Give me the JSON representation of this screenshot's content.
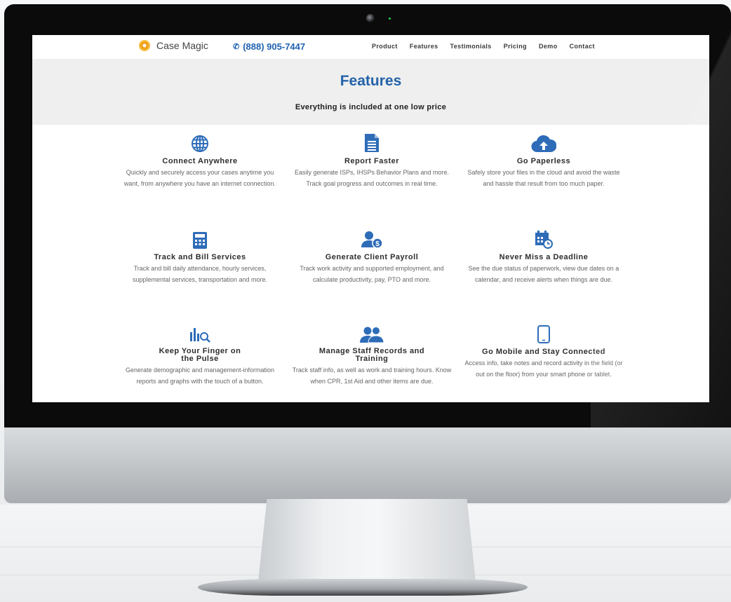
{
  "brand": {
    "name": "Case Magic",
    "phone": "(888) 905-7447"
  },
  "nav": {
    "items": [
      "Product",
      "Features",
      "Testimonials",
      "Pricing",
      "Demo",
      "Contact"
    ]
  },
  "hero": {
    "title": "Features",
    "subtitle": "Everything is included at one low price"
  },
  "colors": {
    "accent": "#2462a8",
    "icon": "#2e6cb8",
    "logo": "#f0a21c"
  },
  "features": [
    {
      "icon": "globe-icon",
      "title": "Connect Anywhere",
      "description": "Quickly and securely access your cases anytime you want, from anywhere you have an internet connection."
    },
    {
      "icon": "document-icon",
      "title": "Report Faster",
      "description": "Easily generate ISPs, IHSPs Behavior Plans and more. Track goal progress and outcomes in real time."
    },
    {
      "icon": "cloud-upload-icon",
      "title": "Go Paperless",
      "description": "Safely store your files in the cloud and avoid the waste and hassle that result from too much paper."
    },
    {
      "icon": "calculator-icon",
      "title": "Track and Bill Services",
      "description": "Track and bill daily attendance, hourly services, supplemental services, transportation and more."
    },
    {
      "icon": "user-dollar-icon",
      "title": "Generate Client Payroll",
      "description": "Track work activity and supported employment, and calculate productivity, pay, PTO and more."
    },
    {
      "icon": "calendar-clock-icon",
      "title": "Never Miss a Deadline",
      "description": "See the due status of paperwork, view due dates on a calendar, and receive alerts when things are due."
    },
    {
      "icon": "chart-search-icon",
      "title": "Keep Your Finger on the Pulse",
      "description": "Generate demographic and management-information reports and graphs with the touch of a button."
    },
    {
      "icon": "users-icon",
      "title": "Manage Staff Records and Training",
      "description": "Track staff info, as well as work and training hours. Know when CPR, 1st Aid and other items are due."
    },
    {
      "icon": "mobile-icon",
      "title": "Go Mobile and Stay Connected",
      "description": "Access info, take notes and record activity in the field (or out on the floor) from your smart phone or tablet."
    }
  ]
}
